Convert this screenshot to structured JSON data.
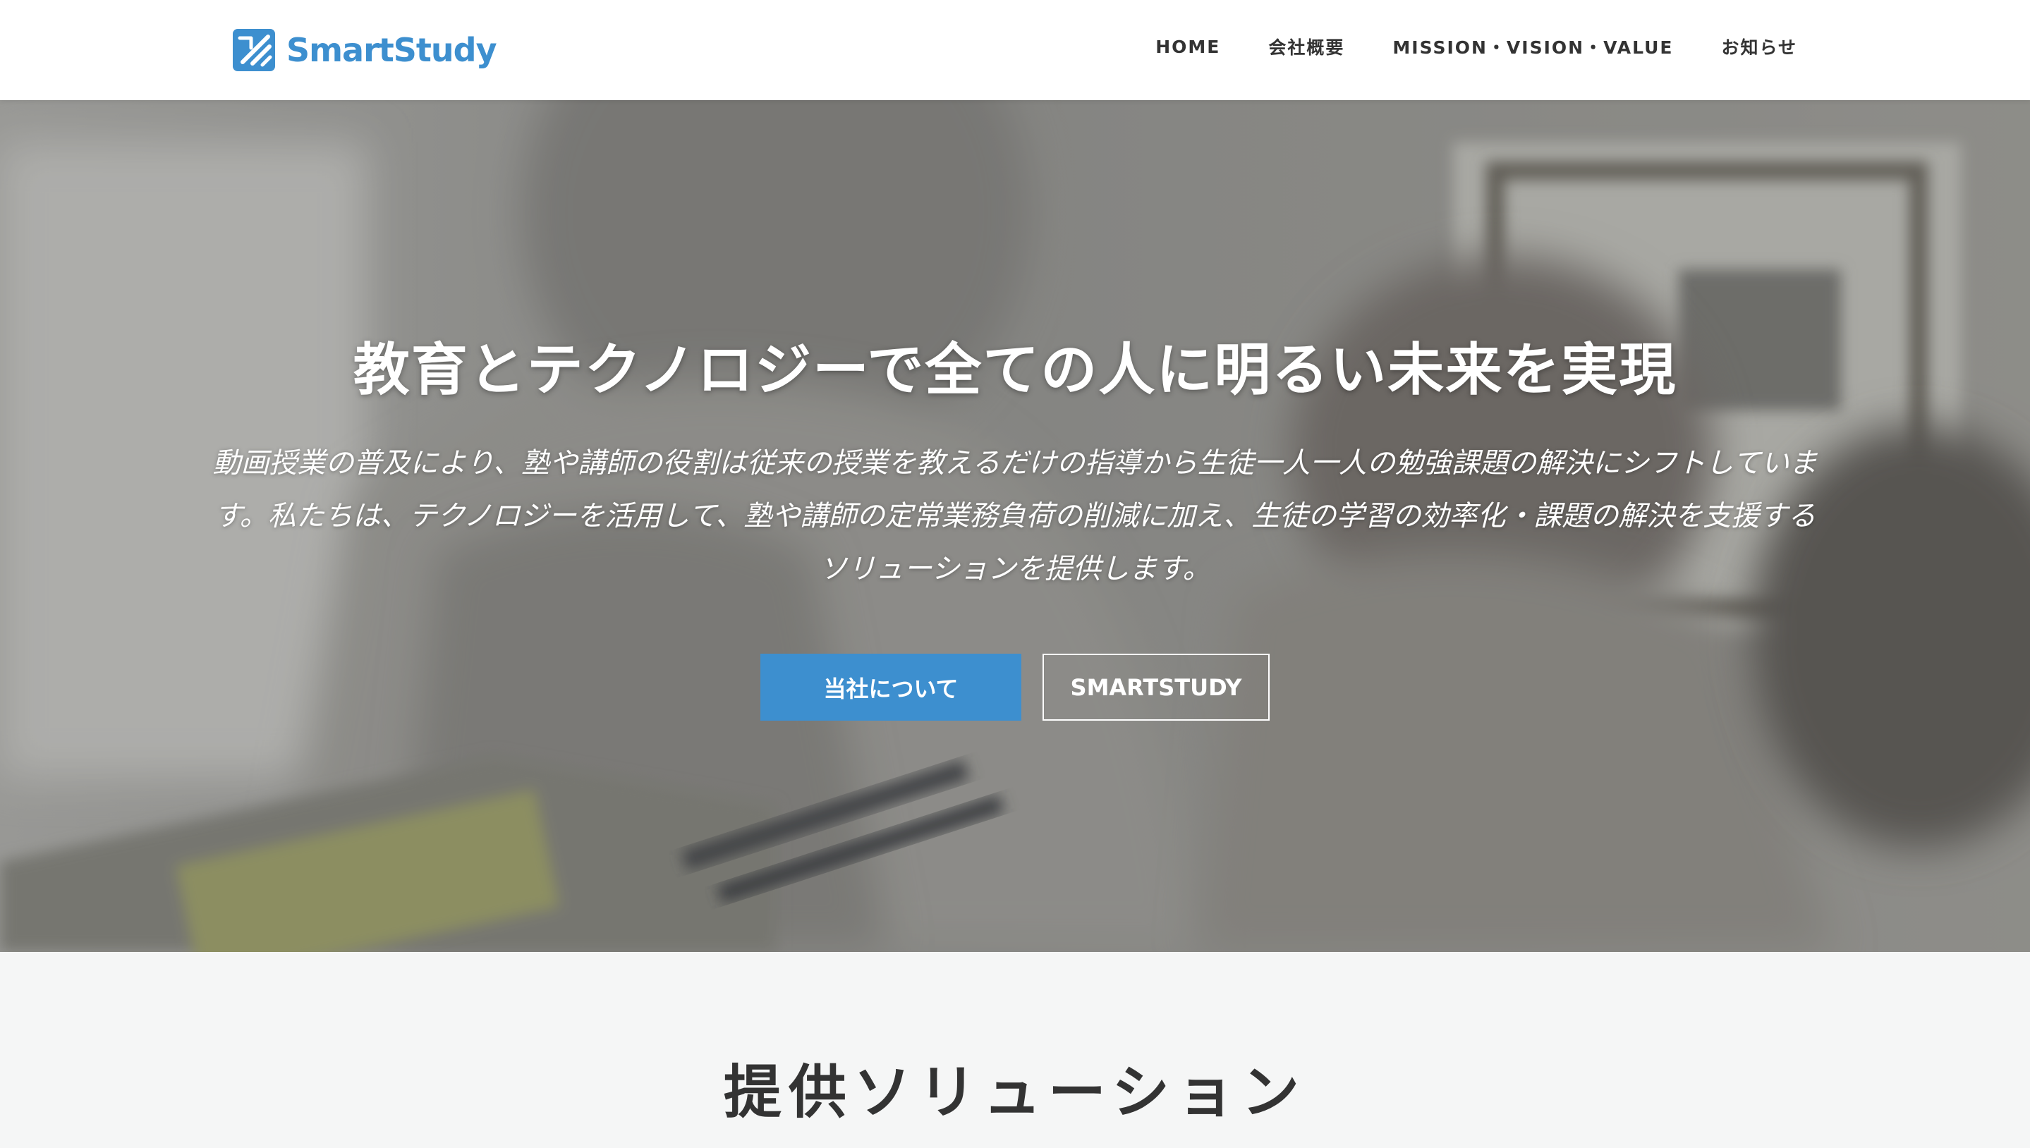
{
  "header": {
    "logo_text": "SmartStudy",
    "nav": [
      {
        "label": "HOME"
      },
      {
        "label": "会社概要"
      },
      {
        "label": "MISSION・VISION・VALUE"
      },
      {
        "label": "お知らせ"
      }
    ]
  },
  "hero": {
    "title": "教育とテクノロジーで全ての人に明るい未来を実現",
    "description": "動画授業の普及により、塾や講師の役割は従来の授業を教えるだけの指導から生徒一人一人の勉強課題の解決にシフトしています。私たちは、テクノロジーを活用して、塾や講師の定常業務負荷の削減に加え、生徒の学習の効率化・課題の解決を支援するソリューションを提供します。",
    "primary_button": "当社について",
    "secondary_button": "SMARTSTUDY"
  },
  "solutions": {
    "title": "提供ソリューション"
  },
  "colors": {
    "accent": "#3d8fcf",
    "header_bg": "#ffffff",
    "nav_text": "#333333",
    "section_bg": "#f5f6f6"
  },
  "icons": {
    "logo": "pencil-check-logo-icon"
  }
}
